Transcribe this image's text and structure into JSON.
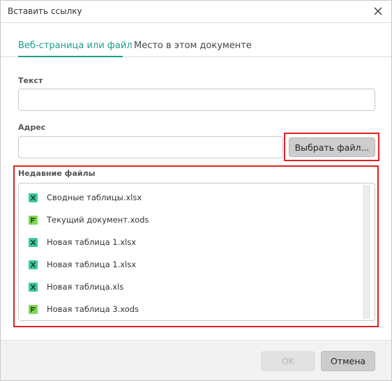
{
  "dialog": {
    "title": "Вставить ссылку"
  },
  "tabs": [
    {
      "label": "Веб-страница или файл",
      "active": true
    },
    {
      "label": "Место в этом документе",
      "active": false
    }
  ],
  "text_field": {
    "label": "Текст",
    "value": ""
  },
  "address_field": {
    "label": "Адрес",
    "value": ""
  },
  "choose_file_label": "Выбрать файл...",
  "recent": {
    "label": "Недавние файлы",
    "files": [
      {
        "name": "Сводные таблицы.xlsx",
        "icon": "spreadsheet-icon"
      },
      {
        "name": "Текущий документ.xods",
        "icon": "xods-icon"
      },
      {
        "name": "Новая таблица 1.xlsx",
        "icon": "spreadsheet-icon"
      },
      {
        "name": "Новая таблица 1.xlsx",
        "icon": "spreadsheet-icon"
      },
      {
        "name": "Новая таблица.xls",
        "icon": "spreadsheet-icon"
      },
      {
        "name": "Новая таблица 3.xods",
        "icon": "xods-icon"
      }
    ]
  },
  "footer": {
    "ok_label": "OK",
    "cancel_label": "Отмена"
  },
  "colors": {
    "accent": "#1e9d8c",
    "highlight": "#e02020",
    "spreadsheet_icon": "#3dc99a",
    "xods_icon": "#7ed957"
  }
}
